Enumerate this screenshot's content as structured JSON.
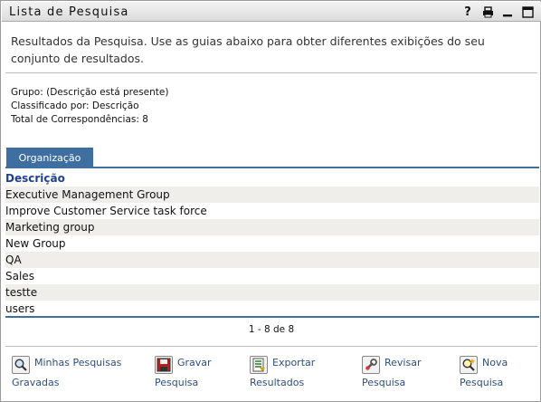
{
  "window": {
    "title": "Lista de Pesquisa",
    "controls": [
      "help-icon",
      "print-icon",
      "minimize-icon",
      "maximize-icon"
    ]
  },
  "description": "Resultados da Pesquisa. Use as guias abaixo para obter diferentes exibições do seu conjunto de resultados.",
  "meta": {
    "group_label": "Grupo:",
    "group_value": "(Descrição está presente)",
    "sorted_label": "Classificado por:",
    "sorted_value": "Descrição",
    "total_label": "Total de Correspondências:",
    "total_value": "8"
  },
  "tabs": [
    {
      "label": "Organização",
      "selected": true
    }
  ],
  "table": {
    "header": "Descrição",
    "rows": [
      "Executive Management Group",
      "Improve Customer Service task force",
      "Marketing group",
      "New Group",
      "QA",
      "Sales",
      "testte",
      "users"
    ]
  },
  "pager": "1 - 8 de 8",
  "actions": [
    {
      "line1": "Minhas Pesquisas",
      "line2": "Gravadas",
      "icon": "magnifier-icon"
    },
    {
      "line1": "Gravar",
      "line2": "Pesquisa",
      "icon": "floppy-disk-icon"
    },
    {
      "line1": "Exportar",
      "line2": "Resultados",
      "icon": "export-list-icon"
    },
    {
      "line1": "Revisar",
      "line2": "Pesquisa",
      "icon": "wrench-edit-icon"
    },
    {
      "line1": "Nova",
      "line2": "Pesquisa",
      "icon": "new-search-icon"
    }
  ],
  "colors": {
    "tab_blue": "#3f6fa0",
    "header_blue": "#1f3f8f",
    "link_blue": "#2d4f7f",
    "row_stripe": "#efeeea"
  }
}
